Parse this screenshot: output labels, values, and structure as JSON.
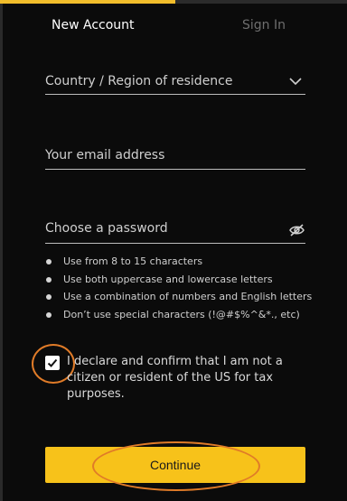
{
  "tabs": {
    "new_account": "New Account",
    "sign_in": "Sign In"
  },
  "form": {
    "country_placeholder": "Country / Region of residence",
    "email_placeholder": "Your email address",
    "password_placeholder": "Choose a password",
    "password_rules": [
      "Use from 8 to 15 characters",
      "Use both uppercase and lowercase letters",
      "Use a combination of numbers and English letters",
      "Don’t use special characters (!@#$%^&*., etc)"
    ],
    "declaration": "I declare and confirm that I am not a citizen or resident of the US for tax purposes.",
    "declaration_checked": true,
    "continue_label": "Continue"
  },
  "icons": {
    "country_dropdown": "chevron-down-icon",
    "password_visibility": "eye-off-icon",
    "checkbox": "checkmark-icon"
  },
  "colors": {
    "accent": "#f7c21a",
    "tab_active_underline": "#f2bd2b",
    "annotation_circle": "#e07b28",
    "background": "#0b0b0b"
  }
}
